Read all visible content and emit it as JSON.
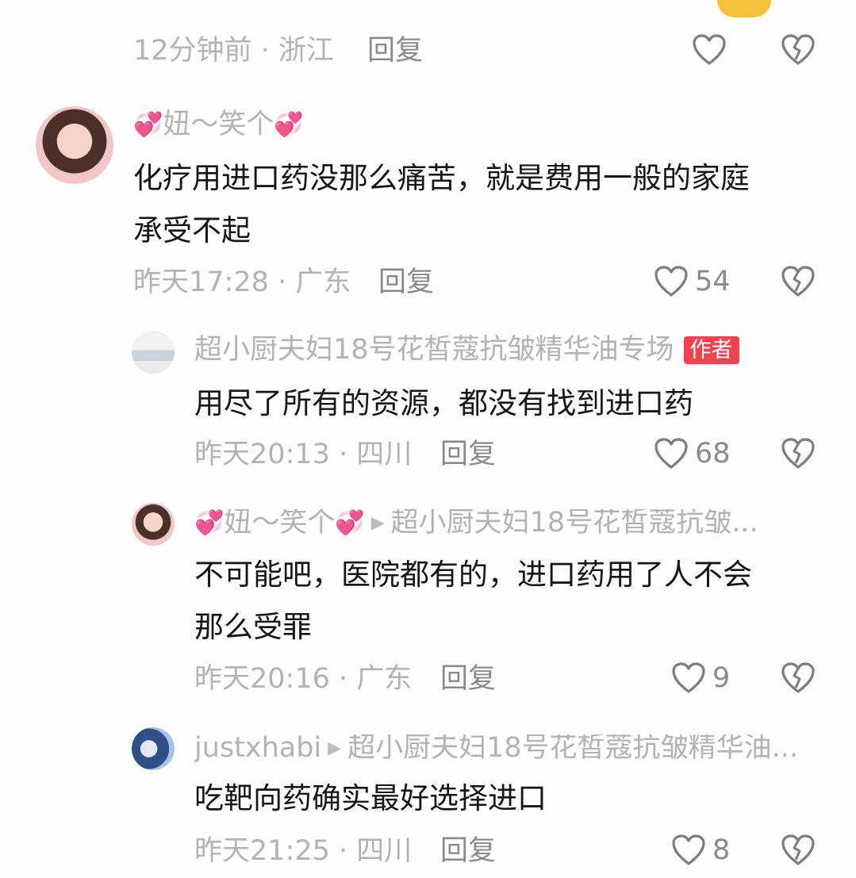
{
  "comments": [
    {
      "time": "12分钟前 · 浙江",
      "reply": "回复",
      "likes": ""
    },
    {
      "name": "妞～笑个",
      "text_lines": [
        "化疗用进口药没那么痛苦，就是费用一般的家庭",
        "承受不起"
      ],
      "time": "昨天17:28 · 广东",
      "reply": "回复",
      "likes": "54"
    },
    {
      "name": "超小厨夫妇18号花皙蔻抗皱精华油专场",
      "badge": "作者",
      "text_lines": [
        "用尽了所有的资源，都没有找到进口药"
      ],
      "time": "昨天20:13 · 四川",
      "reply": "回复",
      "likes": "68"
    },
    {
      "name": "妞～笑个",
      "reply_to": "超小厨夫妇18号花皙蔻抗皱...",
      "text_lines": [
        "不可能吧，医院都有的，进口药用了人不会",
        "那么受罪"
      ],
      "time": "昨天20:16 · 广东",
      "reply": "回复",
      "likes": "9"
    },
    {
      "name": "justxhabi",
      "reply_to": "超小厨夫妇18号花皙蔻抗皱精华油...",
      "text_lines": [
        "吃靶向药确实最好选择进口"
      ],
      "time": "昨天21:25 · 四川",
      "reply": "回复",
      "likes": "8"
    }
  ],
  "icons": {
    "like": "heart-outline-icon",
    "dislike": "broken-heart-icon",
    "reply_arrow": "play-arrow-icon",
    "name_emoji": "sparkling-hearts-emoji"
  },
  "colors": {
    "badge": "#f2414f",
    "meta_text": "#b3b3b3",
    "reply_text": "#8a8a8a",
    "body_text": "#161616"
  }
}
